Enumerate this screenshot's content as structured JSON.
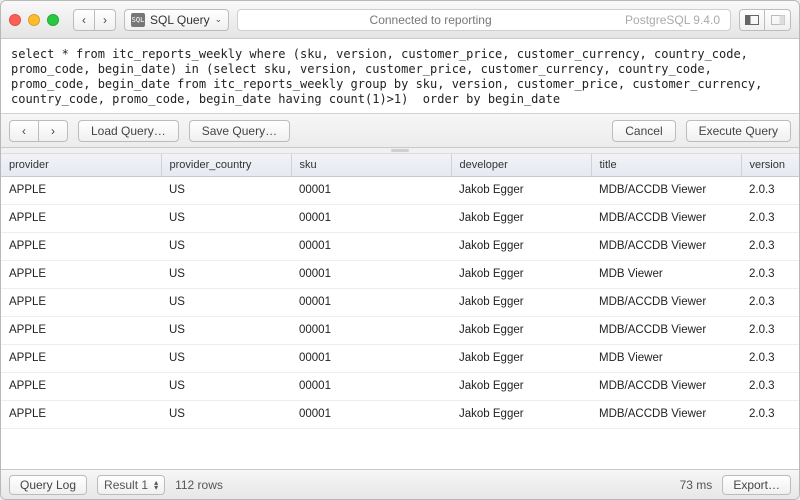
{
  "titlebar": {
    "query_type_label": "SQL Query",
    "connection_status": "Connected to reporting",
    "db_version": "PostgreSQL 9.4.0"
  },
  "sql_text": "select * from itc_reports_weekly where (sku, version, customer_price, customer_currency, country_code, promo_code, begin_date) in (select sku, version, customer_price, customer_currency, country_code, promo_code, begin_date from itc_reports_weekly group by sku, version, customer_price, customer_currency, country_code, promo_code, begin_date having count(1)>1)  order by begin_date",
  "actions": {
    "load": "Load Query…",
    "save": "Save Query…",
    "cancel": "Cancel",
    "execute": "Execute Query"
  },
  "columns": [
    "provider",
    "provider_country",
    "sku",
    "developer",
    "title",
    "version"
  ],
  "rows": [
    {
      "provider": "APPLE",
      "provider_country": "US",
      "sku": "00001",
      "developer": "Jakob Egger",
      "title": "MDB/ACCDB Viewer",
      "version": "2.0.3"
    },
    {
      "provider": "APPLE",
      "provider_country": "US",
      "sku": "00001",
      "developer": "Jakob Egger",
      "title": "MDB/ACCDB Viewer",
      "version": "2.0.3"
    },
    {
      "provider": "APPLE",
      "provider_country": "US",
      "sku": "00001",
      "developer": "Jakob Egger",
      "title": "MDB/ACCDB Viewer",
      "version": "2.0.3"
    },
    {
      "provider": "APPLE",
      "provider_country": "US",
      "sku": "00001",
      "developer": "Jakob Egger",
      "title": "MDB Viewer",
      "version": "2.0.3"
    },
    {
      "provider": "APPLE",
      "provider_country": "US",
      "sku": "00001",
      "developer": "Jakob Egger",
      "title": "MDB/ACCDB Viewer",
      "version": "2.0.3"
    },
    {
      "provider": "APPLE",
      "provider_country": "US",
      "sku": "00001",
      "developer": "Jakob Egger",
      "title": "MDB/ACCDB Viewer",
      "version": "2.0.3"
    },
    {
      "provider": "APPLE",
      "provider_country": "US",
      "sku": "00001",
      "developer": "Jakob Egger",
      "title": "MDB Viewer",
      "version": "2.0.3"
    },
    {
      "provider": "APPLE",
      "provider_country": "US",
      "sku": "00001",
      "developer": "Jakob Egger",
      "title": "MDB/ACCDB Viewer",
      "version": "2.0.3"
    },
    {
      "provider": "APPLE",
      "provider_country": "US",
      "sku": "00001",
      "developer": "Jakob Egger",
      "title": "MDB/ACCDB Viewer",
      "version": "2.0.3"
    }
  ],
  "status": {
    "query_log": "Query Log",
    "result_label": "Result 1",
    "row_count": "112 rows",
    "timing": "73 ms",
    "export": "Export…"
  }
}
